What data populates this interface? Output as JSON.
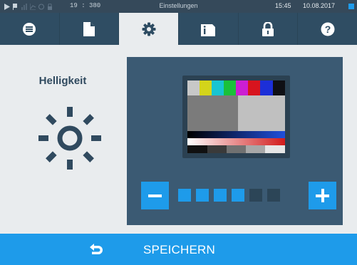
{
  "statusbar": {
    "counter": "19 : 380",
    "title": "Einstellungen",
    "time": "15:45",
    "date": "10.08.2017"
  },
  "tabs": [
    {
      "icon": "list-icon",
      "active": false
    },
    {
      "icon": "document-icon",
      "active": false
    },
    {
      "icon": "gear-icon",
      "active": true
    },
    {
      "icon": "info-sd-card-icon",
      "active": false
    },
    {
      "icon": "lock-icon",
      "active": false
    },
    {
      "icon": "help-icon",
      "active": false
    }
  ],
  "setting": {
    "label": "Helligkeit",
    "icon": "sun-icon"
  },
  "brightness": {
    "level": 4,
    "max": 6
  },
  "footer": {
    "back_icon": "back-arrow-icon",
    "save_label": "SPEICHERN"
  },
  "colors": {
    "accent": "#1e9bea",
    "panel": "#3b5a73",
    "header": "#2f4d63",
    "text": "#304a5f"
  }
}
